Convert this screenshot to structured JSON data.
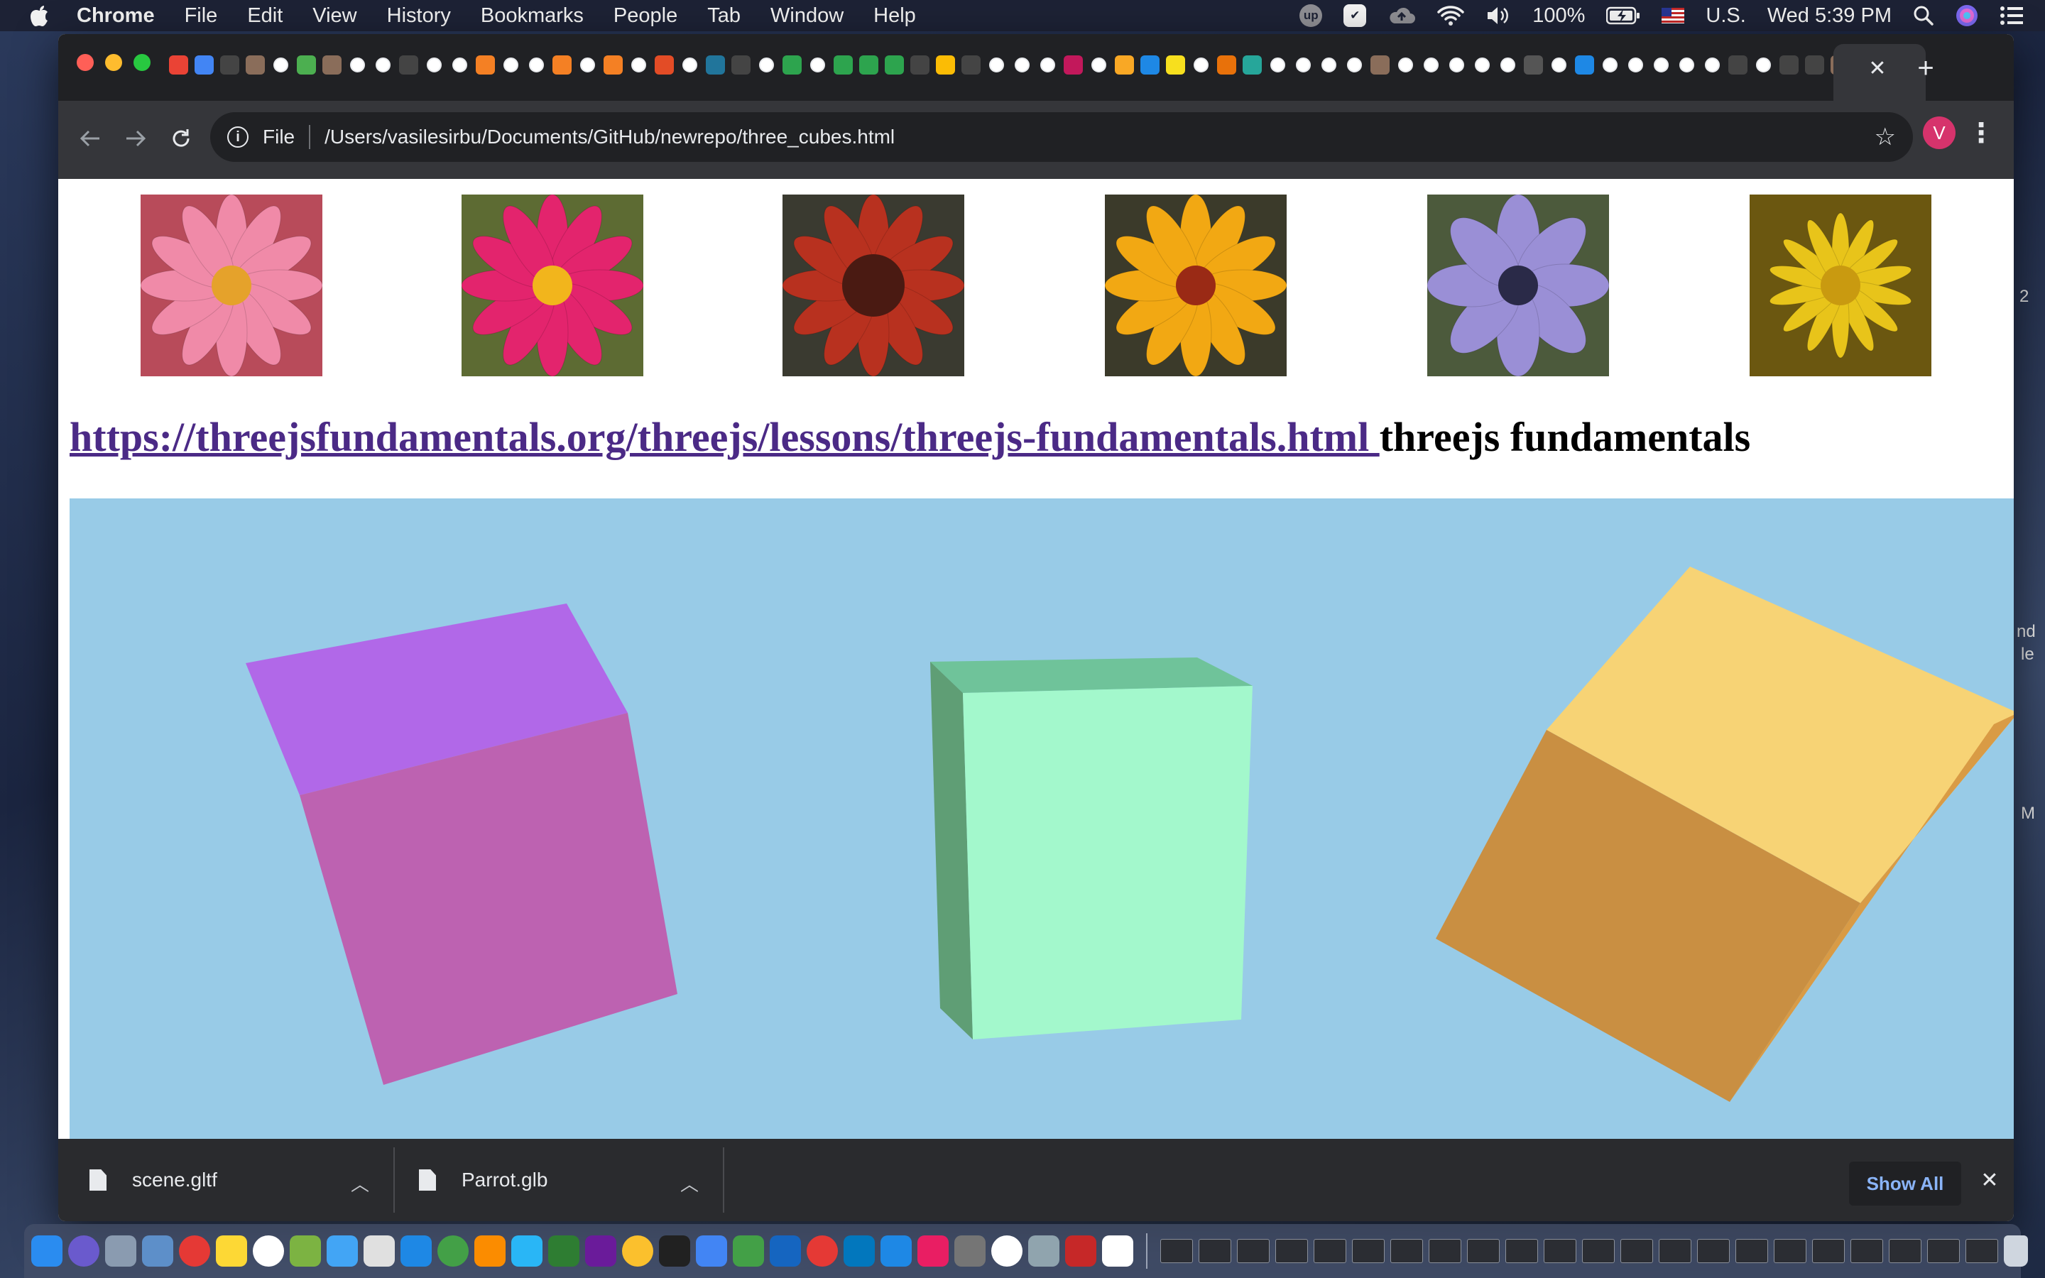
{
  "menubar": {
    "app_name": "Chrome",
    "items": [
      "File",
      "Edit",
      "View",
      "History",
      "Bookmarks",
      "People",
      "Tab",
      "Window",
      "Help"
    ],
    "battery": "100%",
    "input_source": "U.S.",
    "clock": "Wed 5:39 PM",
    "upwork_badge": "up"
  },
  "browser": {
    "url_scheme": "File",
    "url_path": "/Users/vasilesirbu/Documents/GitHub/newrepo/three_cubes.html",
    "avatar_letter": "V",
    "tab_favicon_colors": [
      "#ea4335",
      "#4285f4",
      "#444444",
      "#8a6d5a",
      "#ffffff",
      "#4caf50",
      "#8a6d5a",
      "#ffffff",
      "#ffffff",
      "#444444",
      "#ffffff",
      "#ffffff",
      "#f48024",
      "#ffffff",
      "#ffffff",
      "#f48024",
      "#ffffff",
      "#f48024",
      "#ffffff",
      "#e34c26",
      "#ffffff",
      "#21759b",
      "#444444",
      "#ffffff",
      "#2da44e",
      "#ffffff",
      "#2da44e",
      "#2da44e",
      "#2da44e",
      "#444444",
      "#fbbc05",
      "#444444",
      "#ffffff",
      "#ffffff",
      "#ffffff",
      "#c2185b",
      "#ffffff",
      "#f9a825",
      "#1e88e5",
      "#f7df1e",
      "#ffffff",
      "#e8710a",
      "#26a69a",
      "#ffffff",
      "#ffffff",
      "#ffffff",
      "#ffffff",
      "#8a6d5a",
      "#ffffff",
      "#ffffff",
      "#ffffff",
      "#ffffff",
      "#ffffff",
      "#555555",
      "#ffffff",
      "#1e88e5",
      "#ffffff",
      "#ffffff",
      "#ffffff",
      "#ffffff",
      "#ffffff",
      "#444444",
      "#ffffff",
      "#444444",
      "#444444",
      "#8a6d5a",
      "#ffffff"
    ]
  },
  "page": {
    "flowers": [
      {
        "name": "pink-blossom",
        "petal": "#f08aa8",
        "center": "#e5a22b",
        "bg": "#b84b5a"
      },
      {
        "name": "magenta-cosmos",
        "petal": "#e3246d",
        "center": "#f2b51c",
        "bg": "#5d6b33"
      },
      {
        "name": "red-gaillardia",
        "petal": "#b8311f",
        "center": "#4a1a12",
        "bg": "#3a3a30"
      },
      {
        "name": "striped-gazania",
        "petal": "#f2a813",
        "center": "#9a2a15",
        "bg": "#3b3a2a"
      },
      {
        "name": "purple-anemone",
        "petal": "#9a8fd6",
        "center": "#2a2a48",
        "bg": "#4c5a3c"
      },
      {
        "name": "yellow-star-flower",
        "petal": "#e8c41a",
        "center": "#c99a10",
        "bg": "#6b5710"
      }
    ],
    "link_text": "https://threejsfundamentals.org/threejs/lessons/threejs-fundamentals.html ",
    "heading_text": "threejs fundamentals",
    "canvas_bg": "#98cbe7",
    "cubes": [
      {
        "name": "purple-cube",
        "top": "#b168e8",
        "front": "#bd62b1",
        "side": "#a855a0"
      },
      {
        "name": "mint-cube",
        "top": "#6fc39a",
        "front": "#a3f8cc",
        "side": "#5f9e75"
      },
      {
        "name": "orange-cube",
        "top": "#f7d375",
        "front": "#c98f42",
        "side": "#d99b45"
      }
    ]
  },
  "downloads": {
    "items": [
      {
        "filename": "scene.gltf"
      },
      {
        "filename": "Parrot.glb"
      }
    ],
    "show_all": "Show All"
  },
  "side_text": {
    "a": "2",
    "b": "nd",
    "c": "le",
    "d": "M"
  },
  "dock": {
    "icon_colors": [
      "#2a8cf0",
      "#6a5acd",
      "#8a9bb0",
      "#5d8fc9",
      "#e53935",
      "#fdd835",
      "#ffffff",
      "#7cb342",
      "#42a5f5",
      "#e0e0e0",
      "#1e88e5",
      "#43a047",
      "#fb8c00",
      "#29b6f6",
      "#2e7d32",
      "#6a1b9a",
      "#fbc02d",
      "#212121",
      "#4285f4",
      "#43a047",
      "#1565c0",
      "#e53935",
      "#0277bd",
      "#1e88e5",
      "#e91e63",
      "#757575",
      "#ffffff",
      "#90a4ae",
      "#c62828",
      "#ffffff"
    ]
  }
}
